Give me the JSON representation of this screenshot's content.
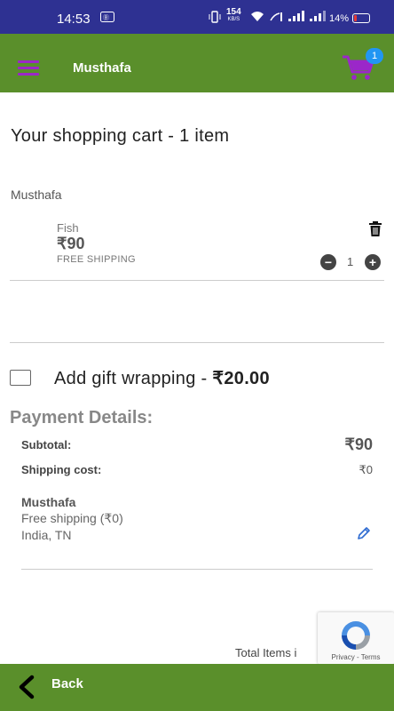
{
  "status_bar": {
    "time": "14:53",
    "network_speed": "154",
    "network_unit": "KB/S",
    "battery": "14%"
  },
  "app_bar": {
    "store_name": "Musthafa",
    "cart_count": "1",
    "accent_color": "#5a8f2b",
    "icon_color": "#9b27c9"
  },
  "cart": {
    "title": "Your shopping cart - 1 item",
    "seller": "Musthafa",
    "items": [
      {
        "name": "Fish",
        "price": "₹90",
        "shipping": "FREE SHIPPING",
        "quantity": "1"
      }
    ]
  },
  "gift": {
    "label": "Add gift wrapping - ",
    "price": "₹20.00",
    "checked": false
  },
  "payment": {
    "title": "Payment Details:",
    "subtotal_label": "Subtotal:",
    "subtotal_value": "₹90",
    "shipping_label": "Shipping cost:",
    "shipping_value": "₹0",
    "address_name": "Musthafa",
    "shipping_method": "Free shipping (₹0)",
    "location": "India, TN"
  },
  "footer": {
    "total_items_text": "Total Items i",
    "recaptcha_links": "Privacy - Terms",
    "back_label": "Back"
  }
}
